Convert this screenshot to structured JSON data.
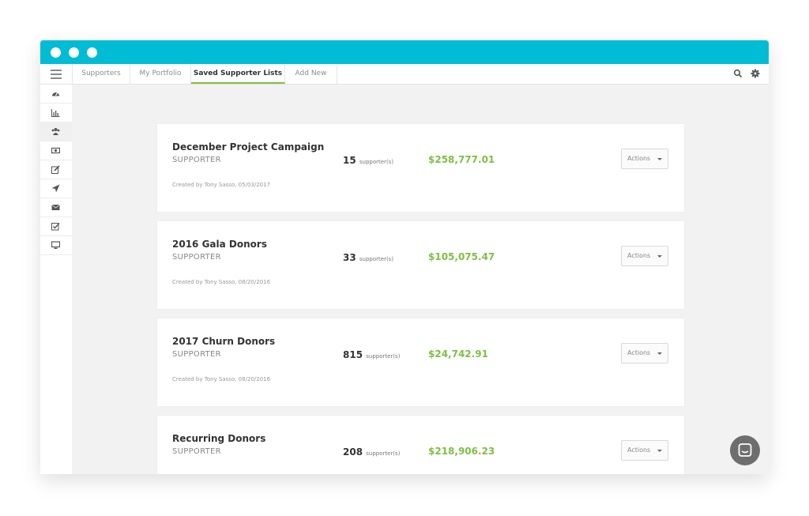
{
  "navbar": {
    "tabs": [
      {
        "label": "Supporters"
      },
      {
        "label": "My Portfolio"
      },
      {
        "label": "Saved Supporter Lists"
      },
      {
        "label": "Add New"
      }
    ],
    "active_tab": "Saved Supporter Lists"
  },
  "sidebar": {
    "items": [
      {
        "icon": "dashboard-icon"
      },
      {
        "icon": "bar-chart-icon"
      },
      {
        "icon": "users-icon",
        "active": true
      },
      {
        "icon": "money-icon"
      },
      {
        "icon": "edit-icon"
      },
      {
        "icon": "send-icon"
      },
      {
        "icon": "envelope-icon"
      },
      {
        "icon": "checklist-icon"
      },
      {
        "icon": "monitor-icon"
      }
    ]
  },
  "lists": [
    {
      "title": "December Project Campaign",
      "type": "SUPPORTER",
      "count": "15",
      "count_label": "supporter(s)",
      "amount": "$258,777.01",
      "created": "Created by Tony Sasso, 05/03/2017",
      "actions_label": "Actions"
    },
    {
      "title": "2016 Gala Donors",
      "type": "SUPPORTER",
      "count": "33",
      "count_label": "supporter(s)",
      "amount": "$105,075.47",
      "created": "Created by Tony Sasso, 08/20/2016",
      "actions_label": "Actions"
    },
    {
      "title": "2017 Churn Donors",
      "type": "SUPPORTER",
      "count": "815",
      "count_label": "supporter(s)",
      "amount": "$24,742.91",
      "created": "Created by Tony Sasso, 08/20/2016",
      "actions_label": "Actions"
    },
    {
      "title": "Recurring Donors",
      "type": "SUPPORTER",
      "count": "208",
      "count_label": "supporter(s)",
      "amount": "$218,906.23",
      "created": "",
      "actions_label": "Actions"
    }
  ],
  "colors": {
    "titlebar": "#00bcd4",
    "accent_green": "#7dc044",
    "background": "#f2f2f3"
  }
}
